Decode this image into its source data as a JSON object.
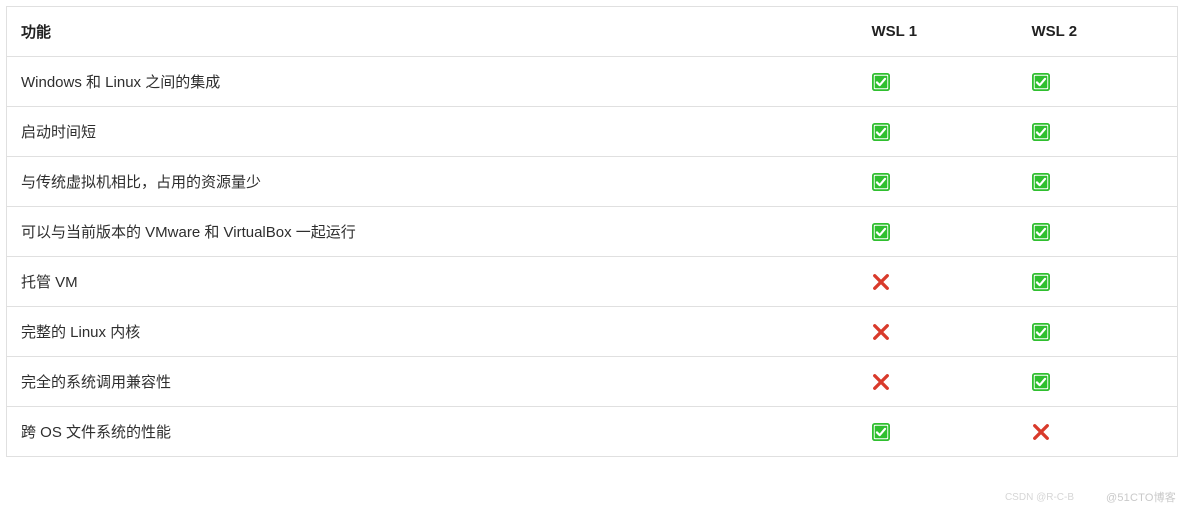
{
  "table": {
    "headers": {
      "feature": "功能",
      "wsl1": "WSL 1",
      "wsl2": "WSL 2"
    },
    "rows": [
      {
        "feature": "Windows 和 Linux 之间的集成",
        "wsl1": true,
        "wsl2": true
      },
      {
        "feature": "启动时间短",
        "wsl1": true,
        "wsl2": true
      },
      {
        "feature": "与传统虚拟机相比，占用的资源量少",
        "wsl1": true,
        "wsl2": true
      },
      {
        "feature": "可以与当前版本的 VMware 和 VirtualBox 一起运行",
        "wsl1": true,
        "wsl2": true
      },
      {
        "feature": "托管 VM",
        "wsl1": false,
        "wsl2": true
      },
      {
        "feature": "完整的 Linux 内核",
        "wsl1": false,
        "wsl2": true
      },
      {
        "feature": "完全的系统调用兼容性",
        "wsl1": false,
        "wsl2": true
      },
      {
        "feature": "跨 OS 文件系统的性能",
        "wsl1": true,
        "wsl2": false
      }
    ]
  },
  "icons": {
    "check_alt": "支持",
    "cross_alt": "不支持"
  },
  "watermark": {
    "primary": "@51CTO博客",
    "secondary": "CSDN @R-C-B"
  }
}
